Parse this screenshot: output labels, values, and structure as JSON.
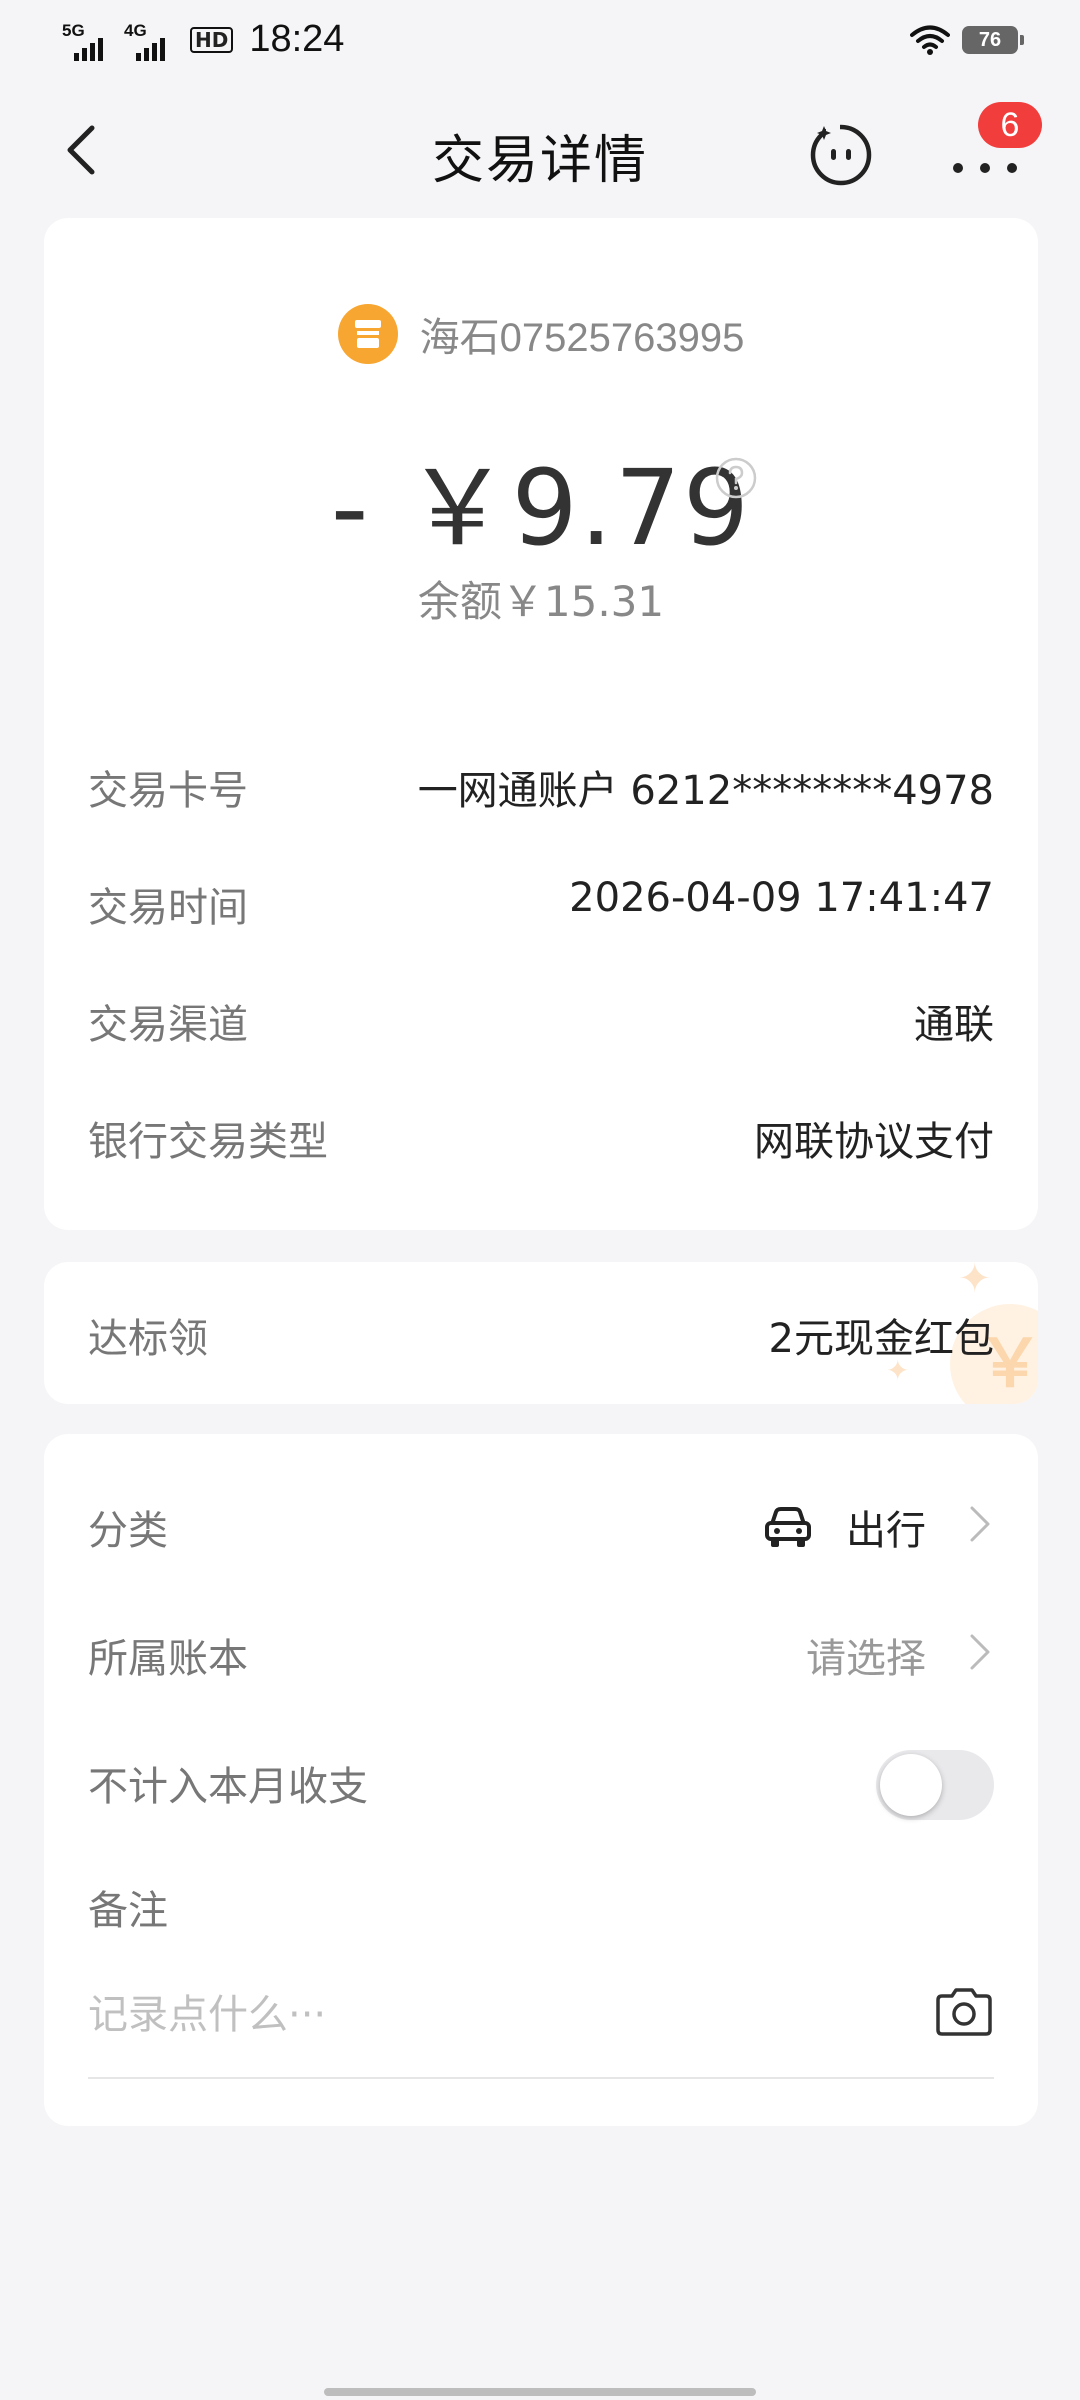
{
  "status_bar": {
    "net1": "5G",
    "net2": "4G",
    "hd": "HD",
    "time": "18:24",
    "battery": "76"
  },
  "nav": {
    "title": "交易详情",
    "badge": "6"
  },
  "transaction": {
    "merchant": "海石07525763995",
    "amount": "- ￥9.79",
    "balance": "余额￥15.31",
    "details": [
      {
        "label": "交易卡号",
        "value": "一网通账户 6212********4978"
      },
      {
        "label": "交易时间",
        "value": "2026-04-09 17:41:47"
      },
      {
        "label": "交易渠道",
        "value": "通联"
      },
      {
        "label": "银行交易类型",
        "value": "网联协议支付"
      }
    ]
  },
  "promo": {
    "label": "达标领",
    "value": "2元现金红包",
    "coin": "￥"
  },
  "record": {
    "category_label": "分类",
    "category_value": "出行",
    "ledger_label": "所属账本",
    "ledger_value": "请选择",
    "exclude_label": "不计入本月收支",
    "exclude_enabled": false,
    "note_label": "备注",
    "note_placeholder": "记录点什么···"
  },
  "colors": {
    "badge": "#f23d3d",
    "merchant_icon": "#f7a631",
    "background": "#f5f5f7"
  },
  "icons": {
    "back": "chevron-left-icon",
    "assistant": "bot-face-icon",
    "more": "more-dots-icon",
    "merchant": "store-icon",
    "help": "question-circle-icon",
    "car": "car-icon",
    "chevron": "chevron-right-icon",
    "camera": "camera-icon"
  }
}
